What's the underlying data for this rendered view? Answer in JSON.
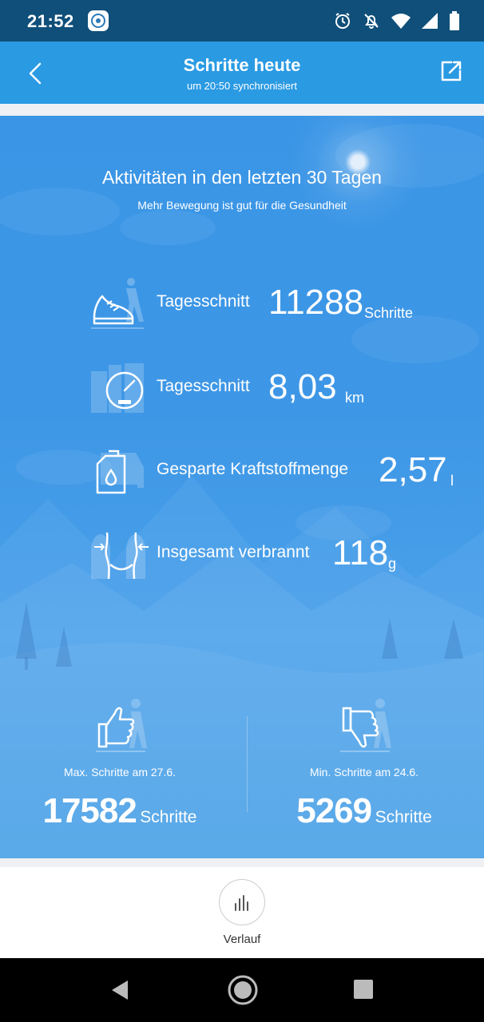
{
  "status_bar": {
    "time": "21:52",
    "icons": [
      "app-notification-icon",
      "alarm-icon",
      "bell-off-icon",
      "wifi-icon",
      "signal-icon",
      "battery-icon"
    ]
  },
  "header": {
    "title": "Schritte heute",
    "subtitle": "um 20:50 synchronisiert",
    "background": "#2a9ae3"
  },
  "card": {
    "heading": "Aktivitäten in den letzten 30 Tagen",
    "subheading": "Mehr Bewegung ist gut für die Gesundheit",
    "background": "#3e97e6",
    "stats": [
      {
        "icon": "shoe-walker-icon",
        "label": "Tagesschnitt",
        "value": "11288",
        "unit": "Schritte"
      },
      {
        "icon": "speedometer-icon",
        "label": "Tagesschnitt",
        "value": "8,03",
        "unit": "km"
      },
      {
        "icon": "fuel-can-icon",
        "label": "Gesparte Kraftstoffmenge",
        "value": "2,57",
        "unit": "l"
      },
      {
        "icon": "waist-icon",
        "label": "Insgesamt verbrannt",
        "value": "118",
        "unit": "g"
      }
    ],
    "max": {
      "icon": "thumbs-up-icon",
      "label": "Max. Schritte am 27.6.",
      "value": "17582",
      "unit": "Schritte"
    },
    "min": {
      "icon": "thumbs-down-icon",
      "label": "Min. Schritte am 24.6.",
      "value": "5269",
      "unit": "Schritte"
    }
  },
  "bottom": {
    "history_label": "Verlauf",
    "history_icon": "bar-chart-icon"
  },
  "nav": [
    "back-nav-icon",
    "home-nav-icon",
    "recents-nav-icon"
  ]
}
